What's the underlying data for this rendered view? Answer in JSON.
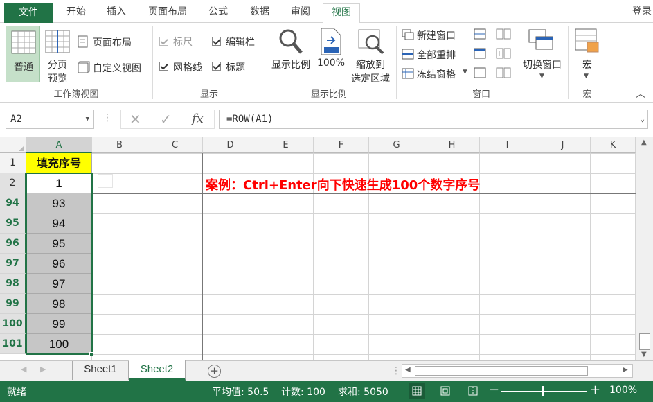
{
  "tabs": {
    "file": "文件",
    "home": "开始",
    "insert": "插入",
    "page_layout": "页面布局",
    "formulas": "公式",
    "data": "数据",
    "review": "审阅",
    "view": "视图",
    "login": "登录"
  },
  "ribbon": {
    "normal": "普通",
    "page_break_1": "分页",
    "page_break_2": "预览",
    "page_layout": "页面布局",
    "custom_views": "自定义视图",
    "group_workbook_views": "工作簿视图",
    "ruler": "标尺",
    "formula_bar": "编辑栏",
    "gridlines": "网格线",
    "headings": "标题",
    "group_show": "显示",
    "zoom": "显示比例",
    "zoom100": "100%",
    "zoom_sel_1": "缩放到",
    "zoom_sel_2": "选定区域",
    "group_zoom": "显示比例",
    "new_window": "新建窗口",
    "arrange_all": "全部重排",
    "freeze_panes": "冻结窗格",
    "switch_windows": "切换窗口",
    "group_window": "窗口",
    "macros": "宏",
    "group_macros": "宏"
  },
  "formula": {
    "name_box": "A2",
    "fx": "fx",
    "content": "=ROW(A1)"
  },
  "columns": [
    "A",
    "B",
    "C",
    "D",
    "E",
    "F",
    "G",
    "H",
    "I",
    "J",
    "K"
  ],
  "rows": [
    {
      "num": "1",
      "a": "填充序号"
    },
    {
      "num": "2",
      "a": "1"
    },
    {
      "num": "94",
      "a": "93"
    },
    {
      "num": "95",
      "a": "94"
    },
    {
      "num": "96",
      "a": "95"
    },
    {
      "num": "97",
      "a": "96"
    },
    {
      "num": "98",
      "a": "97"
    },
    {
      "num": "99",
      "a": "98"
    },
    {
      "num": "100",
      "a": "99"
    },
    {
      "num": "101",
      "a": "100"
    }
  ],
  "annotation": "案例：Ctrl+Enter向下快速生成100个数字序号",
  "sheets": [
    "Sheet1",
    "Sheet2"
  ],
  "status": {
    "ready": "就绪",
    "average": "平均值: 50.5",
    "count": "计数: 100",
    "sum": "求和: 5050",
    "zoom": "100%"
  },
  "colors": {
    "accent": "#217346",
    "header_fill": "#ffff00",
    "selection": "#c6c6c6",
    "annotation": "#ff0000"
  }
}
